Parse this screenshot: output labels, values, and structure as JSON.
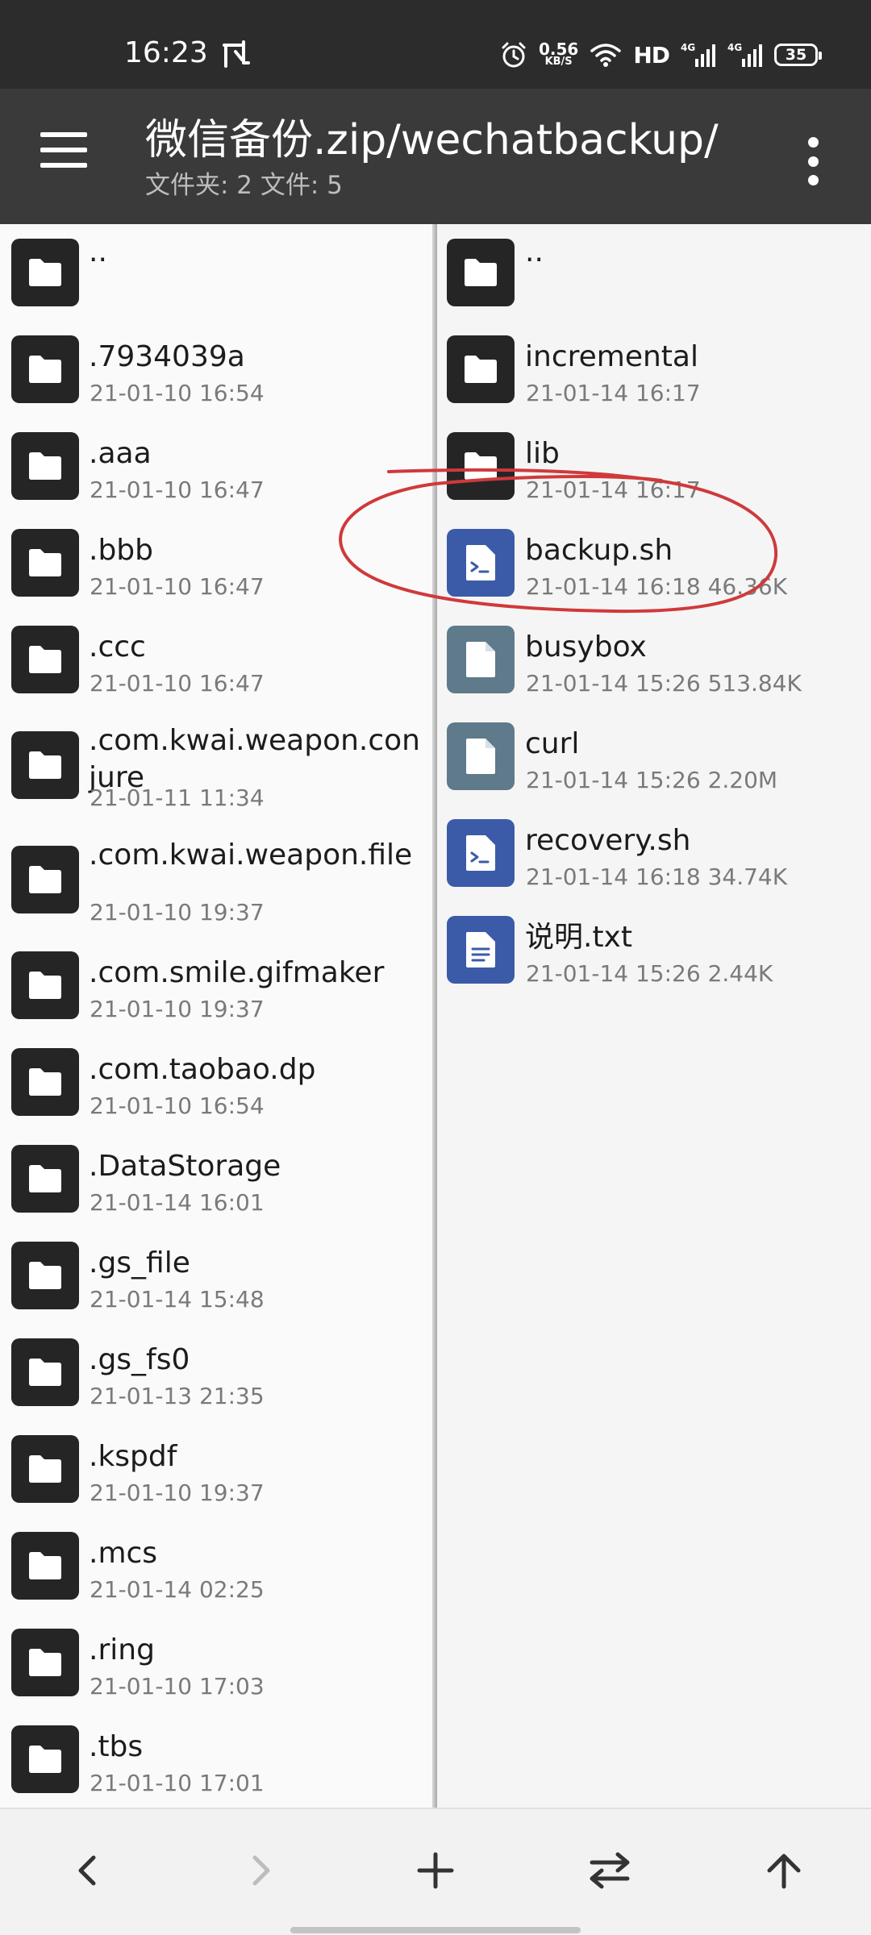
{
  "status_bar": {
    "time": "16:23",
    "net_speed": "0.56",
    "net_unit": "KB/S",
    "hd_label": "HD",
    "signal1": "4G",
    "signal2": "4G",
    "battery": "35",
    "icons": [
      "sync-icon",
      "alarm-icon",
      "wifi-icon",
      "signal-icon",
      "battery-icon"
    ]
  },
  "toolbar": {
    "title": "微信备份.zip/wechatbackup/",
    "subtitle": "文件夹: 2  文件: 5"
  },
  "left_pane": {
    "items": [
      {
        "name": "..",
        "meta": "",
        "type": "folder"
      },
      {
        "name": ".7934039a",
        "meta": "21-01-10 16:54",
        "type": "folder"
      },
      {
        "name": ".aaa",
        "meta": "21-01-10 16:47",
        "type": "folder"
      },
      {
        "name": ".bbb",
        "meta": "21-01-10 16:47",
        "type": "folder"
      },
      {
        "name": ".ccc",
        "meta": "21-01-10 16:47",
        "type": "folder"
      },
      {
        "name": ".com.kwai.weapon.conjure",
        "meta": "21-01-11 11:34",
        "type": "folder"
      },
      {
        "name": ".com.kwai.weapon.file",
        "meta": "21-01-10 19:37",
        "type": "folder"
      },
      {
        "name": ".com.smile.gifmaker",
        "meta": "21-01-10 19:37",
        "type": "folder"
      },
      {
        "name": ".com.taobao.dp",
        "meta": "21-01-10 16:54",
        "type": "folder"
      },
      {
        "name": ".DataStorage",
        "meta": "21-01-14 16:01",
        "type": "folder"
      },
      {
        "name": ".gs_file",
        "meta": "21-01-14 15:48",
        "type": "folder"
      },
      {
        "name": ".gs_fs0",
        "meta": "21-01-13 21:35",
        "type": "folder"
      },
      {
        "name": ".kspdf",
        "meta": "21-01-10 19:37",
        "type": "folder"
      },
      {
        "name": ".mcs",
        "meta": "21-01-14 02:25",
        "type": "folder"
      },
      {
        "name": ".ring",
        "meta": "21-01-10 17:03",
        "type": "folder"
      },
      {
        "name": ".tbs",
        "meta": "21-01-10 17:01",
        "type": "folder"
      }
    ]
  },
  "right_pane": {
    "items": [
      {
        "name": "..",
        "meta": "",
        "type": "folder"
      },
      {
        "name": "incremental",
        "meta": "21-01-14 16:17",
        "type": "folder"
      },
      {
        "name": "lib",
        "meta": "21-01-14 16:17",
        "type": "folder"
      },
      {
        "name": "backup.sh",
        "meta": "21-01-14 16:18  46.36K",
        "type": "script"
      },
      {
        "name": "busybox",
        "meta": "21-01-14 15:26  513.84K",
        "type": "binary"
      },
      {
        "name": "curl",
        "meta": "21-01-14 15:26  2.20M",
        "type": "binary"
      },
      {
        "name": "recovery.sh",
        "meta": "21-01-14 16:18  34.74K",
        "type": "script"
      },
      {
        "name": "说明.txt",
        "meta": "21-01-14 15:26  2.44K",
        "type": "text"
      }
    ]
  },
  "bottom_bar": {
    "buttons": [
      "back-icon",
      "forward-icon",
      "add-icon",
      "swap-icon",
      "up-icon"
    ]
  },
  "colors": {
    "status_bar": "#2c2c2c",
    "toolbar": "#3a3a3a",
    "folder_icon_bg": "#252525",
    "script_icon_bg": "#3b5ba9",
    "binary_icon_bg": "#5f7a8a",
    "annotation": "#d0393b"
  }
}
